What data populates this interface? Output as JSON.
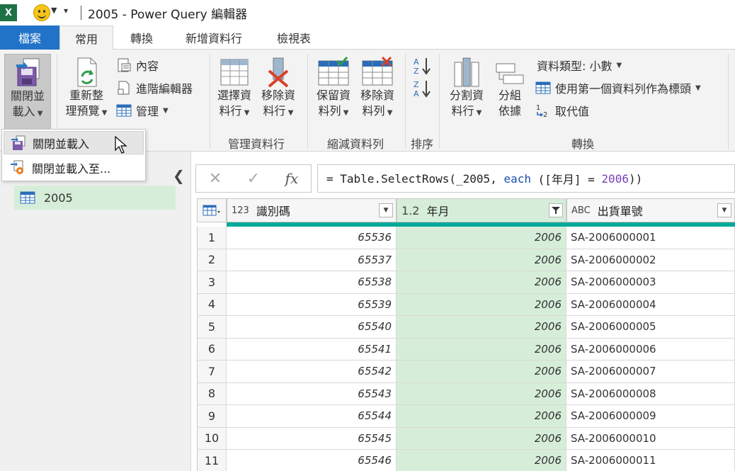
{
  "app": {
    "title": "2005 - Power Query 編輯器"
  },
  "tabs": {
    "file": "檔案",
    "home": "常用",
    "transform": "轉換",
    "add_column": "新增資料行",
    "view": "檢視表"
  },
  "ribbon": {
    "close_load": {
      "line1": "關閉並",
      "line2": "載入"
    },
    "refresh": {
      "line1": "重新整",
      "line2": "理預覽"
    },
    "properties": "內容",
    "advanced_editor": "進階編輯器",
    "manage": "管理",
    "choose_columns": {
      "line1": "選擇資",
      "line2": "料行"
    },
    "remove_columns": {
      "line1": "移除資",
      "line2": "料行"
    },
    "group_manage_columns": "管理資料行",
    "keep_rows": {
      "line1": "保留資",
      "line2": "料列"
    },
    "remove_rows": {
      "line1": "移除資",
      "line2": "料列"
    },
    "group_reduce_rows": "縮減資料列",
    "group_sort": "排序",
    "split_column": {
      "line1": "分割資",
      "line2": "料行"
    },
    "group_by": {
      "line1": "分組",
      "line2": "依據"
    },
    "data_type": "資料類型: 小數",
    "first_row_headers": "使用第一個資料列作為標頭",
    "replace_values": "取代值",
    "group_transform": "轉換"
  },
  "dropdown": {
    "items": [
      "關閉並載入",
      "關閉並載入至..."
    ]
  },
  "queries": {
    "items": [
      "2005"
    ]
  },
  "formula": {
    "prefix": "= Table.SelectRows(_2005, ",
    "keyword": "each",
    "middle": " ([年月] = ",
    "number": "2006",
    "suffix": "))"
  },
  "table": {
    "columns": [
      {
        "type": "123",
        "name": "識別碼"
      },
      {
        "type": "1.2",
        "name": "年月"
      },
      {
        "type": "ABC",
        "name": "出貨單號"
      }
    ],
    "rows": [
      [
        "1",
        "65536",
        "2006",
        "SA-2006000001"
      ],
      [
        "2",
        "65537",
        "2006",
        "SA-2006000002"
      ],
      [
        "3",
        "65538",
        "2006",
        "SA-2006000003"
      ],
      [
        "4",
        "65539",
        "2006",
        "SA-2006000004"
      ],
      [
        "5",
        "65540",
        "2006",
        "SA-2006000005"
      ],
      [
        "6",
        "65541",
        "2006",
        "SA-2006000006"
      ],
      [
        "7",
        "65542",
        "2006",
        "SA-2006000007"
      ],
      [
        "8",
        "65543",
        "2006",
        "SA-2006000008"
      ],
      [
        "9",
        "65544",
        "2006",
        "SA-2006000009"
      ],
      [
        "10",
        "65545",
        "2006",
        "SA-2006000010"
      ],
      [
        "11",
        "65546",
        "2006",
        "SA-2006000011"
      ]
    ]
  },
  "colors": {
    "accent": "#2173c8",
    "selected_column": "#d6eed9",
    "quality_bar": "#00a998",
    "excel_green": "#1e7145"
  }
}
